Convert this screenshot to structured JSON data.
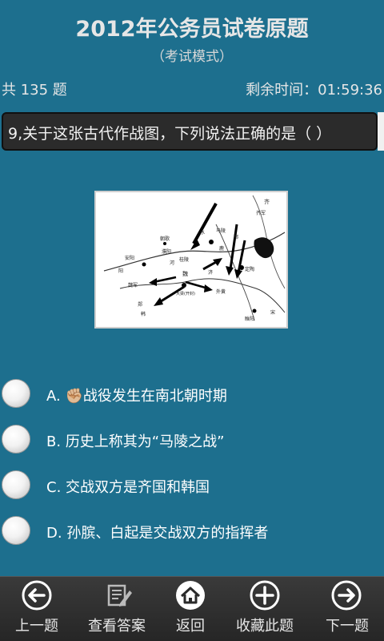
{
  "header": {
    "title": "2012年公务员试卷原题",
    "subtitle": "（考试模式）"
  },
  "status": {
    "count_label": "共 135 题",
    "remaining_label": "剩余时间：01:59:36"
  },
  "question": {
    "text": "9,关于这张古代作战图，下列说法正确的是（ ）"
  },
  "map": {
    "labels": [
      "齐",
      "齐军",
      "马陵",
      "鄄",
      "水",
      "朝歌",
      "濮阳",
      "鹿",
      "桂陵",
      "安阳",
      "魏",
      "济",
      "定陶",
      "大梁(开封)",
      "外黄",
      "魏军",
      "郑",
      "韩",
      "宋",
      "睢阳",
      "河",
      "阳"
    ]
  },
  "options": [
    {
      "letter": "A.",
      "emoji": "✊🏼",
      "text": "战役发生在南北朝时期"
    },
    {
      "letter": "B.",
      "emoji": "",
      "text": "历史上称其为“马陵之战”"
    },
    {
      "letter": "C.",
      "emoji": "",
      "text": "交战双方是齐国和韩国"
    },
    {
      "letter": "D.",
      "emoji": "",
      "text": "孙膑、白起是交战双方的指挥者"
    }
  ],
  "toolbar": {
    "prev_label": "上一题",
    "answer_label": "查看答案",
    "back_label": "返回",
    "fav_label": "收藏此题",
    "next_label": "下一题"
  }
}
